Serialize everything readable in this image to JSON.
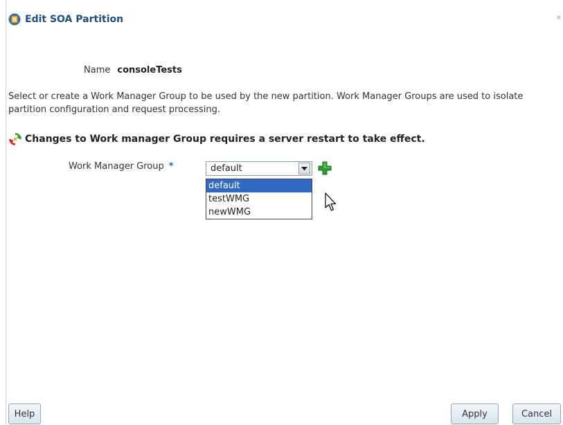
{
  "dialog": {
    "title": "Edit SOA Partition",
    "close_mark": "×"
  },
  "name_row": {
    "label": "Name",
    "value": "consoleTests"
  },
  "description": "Select or create a Work Manager Group to be used by the new partition. Work Manager Groups are used to isolate partition configuration and request processing.",
  "warning": {
    "text": "Changes to Work manager Group requires a server restart to take effect."
  },
  "work_manager_group": {
    "label": "Work Manager Group",
    "required_mark": "*",
    "selected_value": "default",
    "options": [
      "default",
      "testWMG",
      "newWMG"
    ],
    "highlighted_index": 0
  },
  "buttons": {
    "help": "Help",
    "apply": "Apply",
    "cancel": "Cancel"
  },
  "icons": {
    "title": "soa-partition-icon",
    "warning": "restart-icon",
    "add": "add-icon",
    "dropdown": "chevron-down-icon",
    "cursor": "mouse-cursor-icon"
  },
  "colors": {
    "title": "#1f4f7f",
    "required": "#1f6fb5",
    "selection": "#316ac5",
    "add_green": "#2e9b2e"
  }
}
